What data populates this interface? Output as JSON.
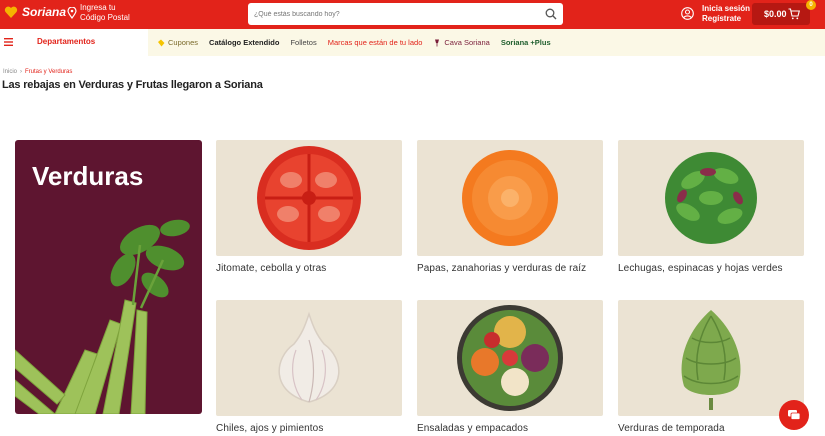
{
  "header": {
    "logo_text": "Soriana",
    "postal_line1": "Ingresa tu",
    "postal_line2": "Código Postal",
    "search_placeholder": "¿Qué estás buscando hoy?",
    "login_line1": "Inicia sesión",
    "login_line2": "Regístrate",
    "cart_amount": "$0.00",
    "cart_count": "0"
  },
  "nav": {
    "departments_label": "Departamentos",
    "items": [
      {
        "label": "Cupones",
        "color": "#7a6a2a"
      },
      {
        "label": "Catálogo Extendido",
        "color": "#222222"
      },
      {
        "label": "Folletos",
        "color": "#444444"
      },
      {
        "label": "Marcas que están de tu lado",
        "color": "#e2231a"
      },
      {
        "label": "Cava Soriana",
        "color": "#7a1e3a"
      },
      {
        "label": "Soriana +Plus",
        "color": "#1f5e2e"
      }
    ]
  },
  "breadcrumb": {
    "home": "Inicio",
    "current": "Frutas y Verduras"
  },
  "page_title": "Las rebajas en Verduras y Frutas llegaron a Soriana",
  "hero": {
    "title": "Verduras",
    "background": "#5e1530"
  },
  "categories": [
    {
      "label": "Jitomate, cebolla y otras",
      "icon": "tomato-image"
    },
    {
      "label": "Papas, zanahorias y verduras de raíz",
      "icon": "carrot-slice-image"
    },
    {
      "label": "Lechugas, espinacas y hojas verdes",
      "icon": "lettuce-image"
    },
    {
      "label": "Chiles, ajos y pimientos",
      "icon": "garlic-image"
    },
    {
      "label": "Ensaladas y empacados",
      "icon": "salad-bowl-image"
    },
    {
      "label": "Verduras de temporada",
      "icon": "artichoke-image"
    }
  ],
  "colors": {
    "brand_red": "#e2231a",
    "card_bg": "#ebe3d3",
    "nav_bg": "#fbf8e6"
  }
}
